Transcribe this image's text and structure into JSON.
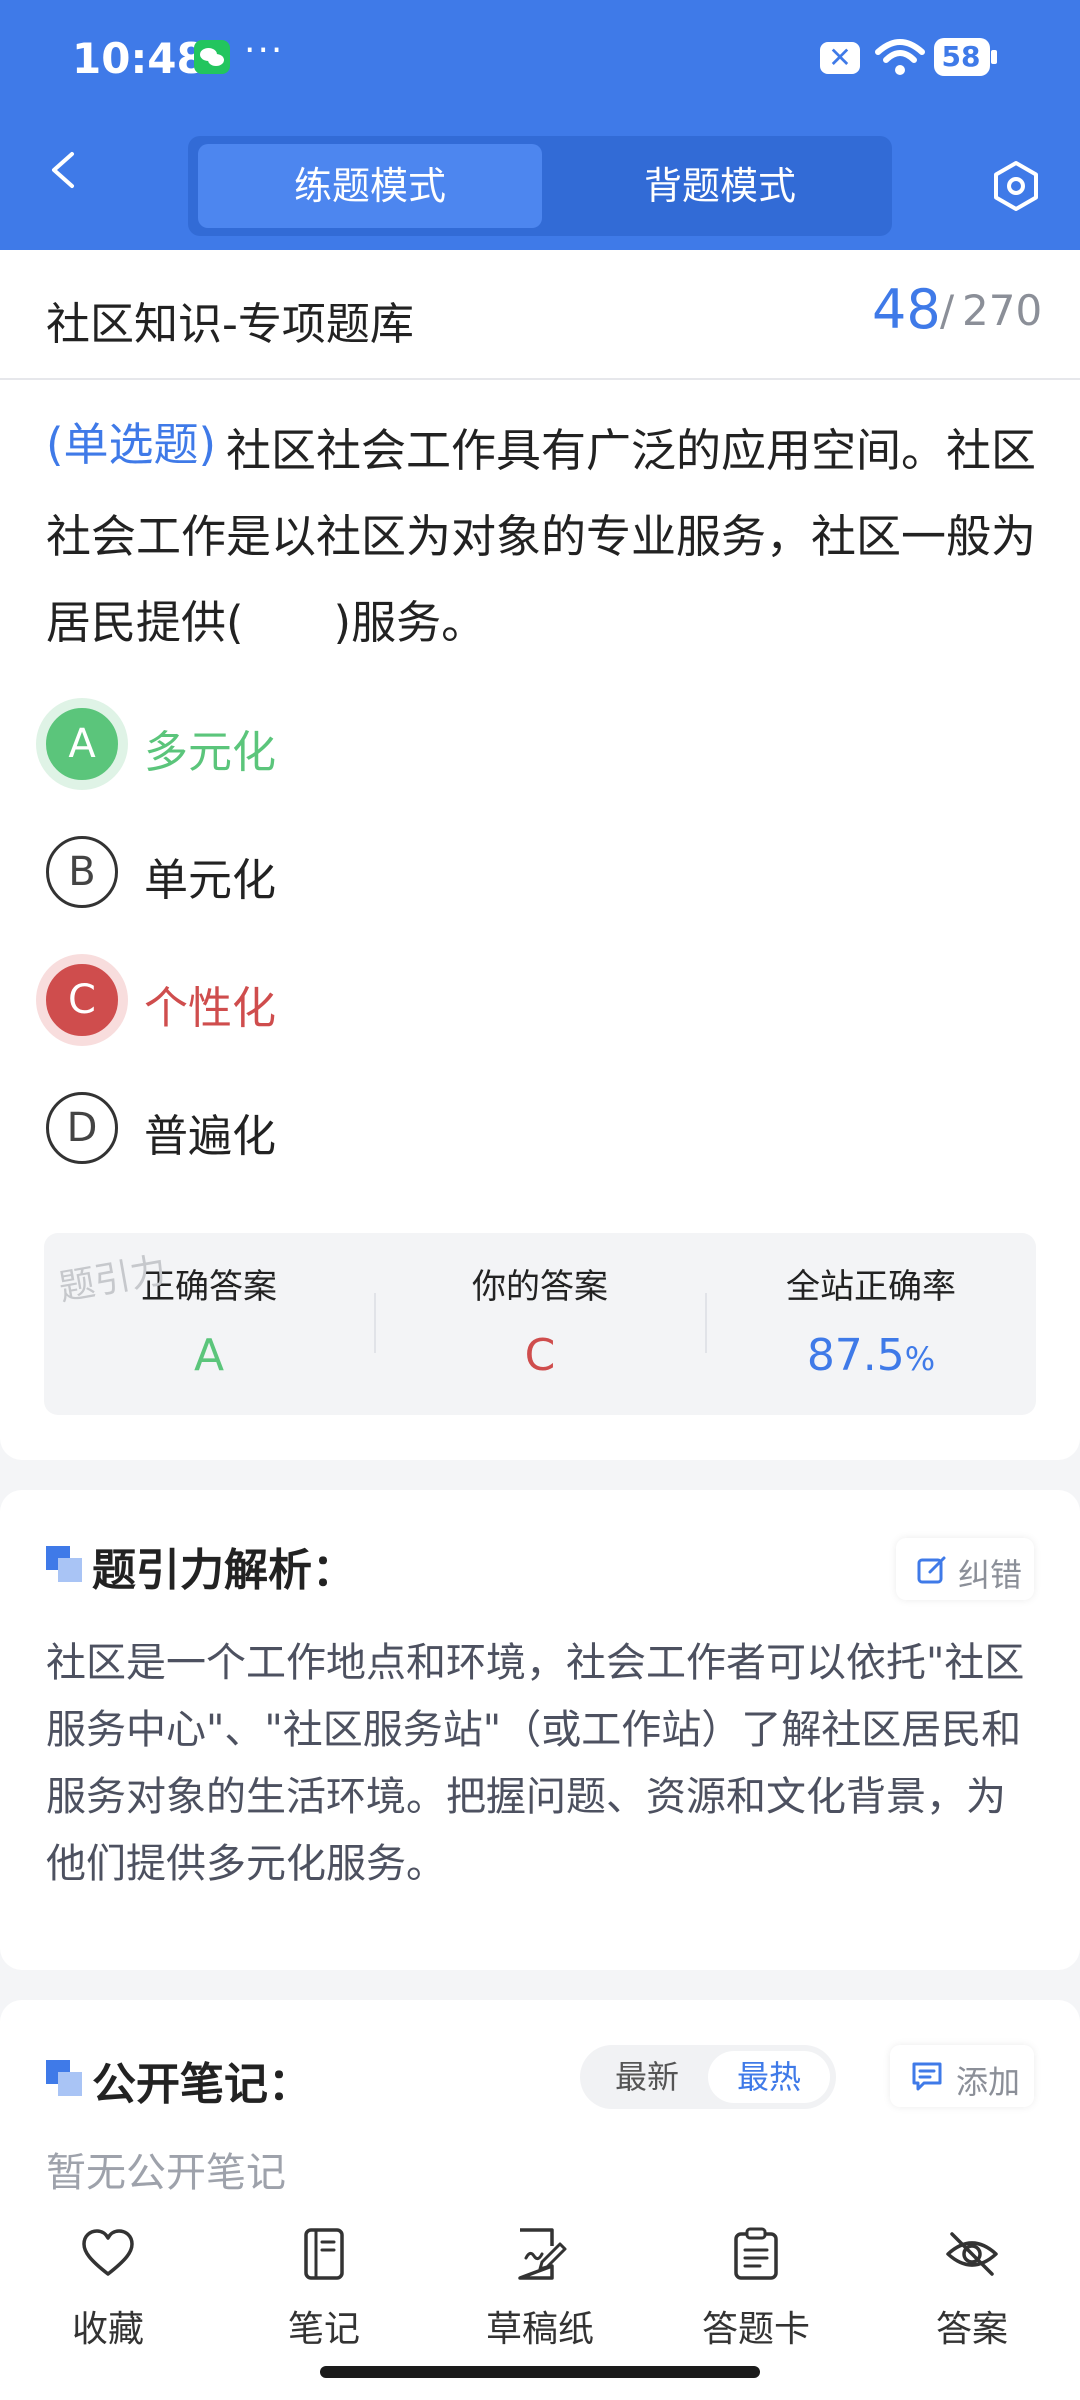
{
  "status_bar": {
    "time": "10:48",
    "more": "···",
    "sim_label": "✕",
    "battery": "58"
  },
  "header": {
    "back_icon": "chevron-left-icon",
    "tabs": [
      {
        "label": "练题模式",
        "active": true
      },
      {
        "label": "背题模式",
        "active": false
      }
    ],
    "settings_icon": "hexagon-settings-icon",
    "accent_color": "#3f7ae8"
  },
  "title_bar": {
    "title": "社区知识-专项题库",
    "current": "48",
    "separator": "/",
    "total": "270"
  },
  "question": {
    "type": "(单选题)",
    "text": "社区社会工作具有广泛的应用空间。社区社会工作是以社区为对象的专业服务，社区一般为居民提供(　　)服务。",
    "options": [
      {
        "letter": "A",
        "text": "多元化",
        "state": "correct"
      },
      {
        "letter": "B",
        "text": "单元化",
        "state": "normal"
      },
      {
        "letter": "C",
        "text": "个性化",
        "state": "wrong"
      },
      {
        "letter": "D",
        "text": "普遍化",
        "state": "normal"
      }
    ]
  },
  "summary": {
    "correct_label": "正确答案",
    "correct_value": "A",
    "your_label": "你的答案",
    "your_value": "C",
    "rate_label": "全站正确率",
    "rate_value": "87.5",
    "rate_unit": "%",
    "watermark": "题引力",
    "correct_color": "#5bc57b",
    "wrong_color": "#cf4d4d"
  },
  "analysis": {
    "title": "题引力解析：",
    "correct_button": "纠错",
    "text": "社区是一个工作地点和环境，社会工作者可以依托\"社区服务中心\"、\"社区服务站\"（或工作站）了解社区居民和服务对象的生活环境。把握问题、资源和文化背景，为他们提供多元化服务。"
  },
  "notes": {
    "title": "公开笔记：",
    "sort_latest": "最新",
    "sort_hot": "最热",
    "add_button": "添加",
    "empty_text": "暂无公开笔记"
  },
  "bottom_bar": {
    "items": [
      {
        "label": "收藏",
        "icon": "heart-icon"
      },
      {
        "label": "笔记",
        "icon": "notebook-icon"
      },
      {
        "label": "草稿纸",
        "icon": "draft-paper-icon"
      },
      {
        "label": "答题卡",
        "icon": "answer-card-icon"
      },
      {
        "label": "答案",
        "icon": "eye-off-icon"
      }
    ]
  }
}
